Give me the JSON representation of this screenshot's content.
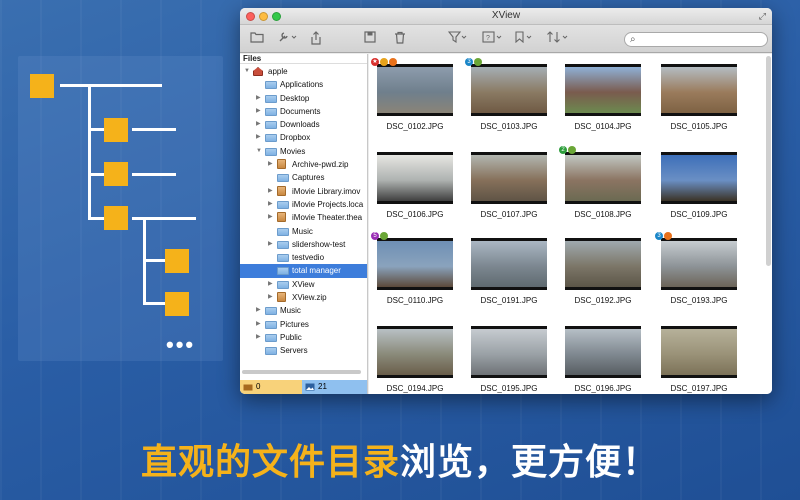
{
  "window": {
    "title": "XView"
  },
  "search": {
    "placeholder": "",
    "icon": "magnifier-icon"
  },
  "toolbar": {
    "icons": [
      "folder-icon",
      "wrench-icon",
      "share-icon",
      "save-icon",
      "trash-icon",
      "filter-icon",
      "rating-icon",
      "label-icon",
      "sort-icon"
    ]
  },
  "sidebar": {
    "header": "Files",
    "items": [
      {
        "label": "apple",
        "level": 0,
        "arrow": "▼",
        "icon": "home"
      },
      {
        "label": "Applications",
        "level": 1,
        "arrow": "",
        "icon": "folder"
      },
      {
        "label": "Desktop",
        "level": 1,
        "arrow": "▶",
        "icon": "folder"
      },
      {
        "label": "Documents",
        "level": 1,
        "arrow": "▶",
        "icon": "folder"
      },
      {
        "label": "Downloads",
        "level": 1,
        "arrow": "▶",
        "icon": "folder"
      },
      {
        "label": "Dropbox",
        "level": 1,
        "arrow": "▶",
        "icon": "folder"
      },
      {
        "label": "Movies",
        "level": 1,
        "arrow": "▼",
        "icon": "folder"
      },
      {
        "label": "Archive-pwd.zip",
        "level": 2,
        "arrow": "▶",
        "icon": "doc"
      },
      {
        "label": "Captures",
        "level": 2,
        "arrow": "",
        "icon": "folder"
      },
      {
        "label": "iMovie Library.imov",
        "level": 2,
        "arrow": "▶",
        "icon": "doc"
      },
      {
        "label": "iMovie Projects.loca",
        "level": 2,
        "arrow": "▶",
        "icon": "folder"
      },
      {
        "label": "iMovie Theater.thea",
        "level": 2,
        "arrow": "▶",
        "icon": "doc"
      },
      {
        "label": "Music",
        "level": 2,
        "arrow": "",
        "icon": "folder"
      },
      {
        "label": "slidershow-test",
        "level": 2,
        "arrow": "▶",
        "icon": "folder"
      },
      {
        "label": "testvedio",
        "level": 2,
        "arrow": "",
        "icon": "folder"
      },
      {
        "label": "total manager",
        "level": 2,
        "arrow": "",
        "icon": "folder",
        "selected": true
      },
      {
        "label": "XView",
        "level": 2,
        "arrow": "▶",
        "icon": "folder"
      },
      {
        "label": "XView.zip",
        "level": 2,
        "arrow": "▶",
        "icon": "doc"
      },
      {
        "label": "Music",
        "level": 1,
        "arrow": "▶",
        "icon": "folder"
      },
      {
        "label": "Pictures",
        "level": 1,
        "arrow": "▶",
        "icon": "folder"
      },
      {
        "label": "Public",
        "level": 1,
        "arrow": "▶",
        "icon": "folder"
      },
      {
        "label": "Servers",
        "level": 1,
        "arrow": "",
        "icon": "folder"
      }
    ]
  },
  "status": {
    "left_count": "0",
    "right_count": "21"
  },
  "thumbnails": [
    {
      "name": "DSC_0102.JPG",
      "colors": [
        "#8d9cad",
        "#6f7f8c",
        "#8a8478"
      ],
      "badges": [
        {
          "c": "#d8302e",
          "t": "★"
        },
        {
          "c": "#e7a21b",
          "t": ""
        },
        {
          "c": "#e8711b",
          "t": ""
        }
      ]
    },
    {
      "name": "DSC_0103.JPG",
      "colors": [
        "#a5aeb4",
        "#8a7a63",
        "#6f5a44"
      ],
      "badges": [
        {
          "c": "#1a86c8",
          "t": "3"
        },
        {
          "c": "#6aa636",
          "t": ""
        }
      ]
    },
    {
      "name": "DSC_0104.JPG",
      "colors": [
        "#8fb0d6",
        "#7a5b4e",
        "#6c8a4f"
      ],
      "badges": []
    },
    {
      "name": "DSC_0105.JPG",
      "colors": [
        "#b4bcc2",
        "#9a7b5c",
        "#7e6243"
      ],
      "badges": []
    },
    {
      "name": "DSC_0106.JPG",
      "colors": [
        "#e6e6e2",
        "#aeb2b0",
        "#3f3f3f"
      ],
      "badges": []
    },
    {
      "name": "DSC_0107.JPG",
      "colors": [
        "#b2b6b0",
        "#86705a",
        "#5f5446"
      ],
      "badges": []
    },
    {
      "name": "DSC_0108.JPG",
      "colors": [
        "#c1c7c2",
        "#8b7462",
        "#6b6a52"
      ],
      "badges": [
        {
          "c": "#2d9e3c",
          "t": "2"
        },
        {
          "c": "#6aa636",
          "t": ""
        }
      ]
    },
    {
      "name": "DSC_0109.JPG",
      "colors": [
        "#3d6fb9",
        "#6a8fc4",
        "#3b3326"
      ],
      "badges": []
    },
    {
      "name": "DSC_0110.JPG",
      "colors": [
        "#6e8fb4",
        "#8aa3bd",
        "#5c4a3a"
      ],
      "badges": [
        {
          "c": "#9a2fb5",
          "t": "5"
        },
        {
          "c": "#6aa636",
          "t": ""
        }
      ]
    },
    {
      "name": "DSC_0191.JPG",
      "colors": [
        "#aab7c3",
        "#7c8790",
        "#5f6a70"
      ],
      "badges": []
    },
    {
      "name": "DSC_0192.JPG",
      "colors": [
        "#9fa9ae",
        "#7c7668",
        "#5c5648"
      ],
      "badges": []
    },
    {
      "name": "DSC_0193.JPG",
      "colors": [
        "#c6ccd0",
        "#8d9397",
        "#6c6458"
      ],
      "badges": [
        {
          "c": "#1a86c8",
          "t": "3"
        },
        {
          "c": "#e8711b",
          "t": ""
        }
      ]
    },
    {
      "name": "DSC_0194.JPG",
      "colors": [
        "#b8c0c4",
        "#8a8a7a",
        "#6a5e4a"
      ],
      "badges": []
    },
    {
      "name": "DSC_0195.JPG",
      "colors": [
        "#c6cbd0",
        "#9aa1a6",
        "#6e7276"
      ],
      "badges": []
    },
    {
      "name": "DSC_0196.JPG",
      "colors": [
        "#b6bfc6",
        "#7f8890",
        "#585e62"
      ],
      "badges": []
    },
    {
      "name": "DSC_0197.JPG",
      "colors": [
        "#b6b19a",
        "#9a9278",
        "#7c7258"
      ],
      "badges": []
    }
  ],
  "caption": {
    "highlight": "直观的文件目录",
    "rest": "浏览，更方便！"
  }
}
